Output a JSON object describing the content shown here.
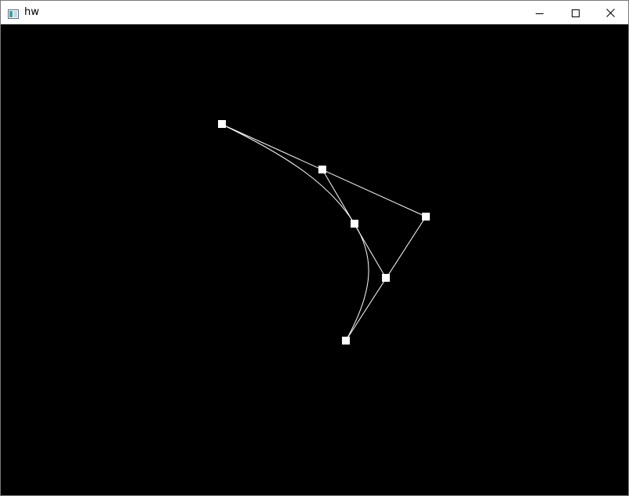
{
  "window": {
    "title": "hw",
    "icon": "app-window-icon",
    "controls": {
      "minimize_icon": "minimize-icon",
      "maximize_icon": "maximize-icon",
      "close_icon": "close-icon"
    }
  },
  "canvas": {
    "background": "#000000",
    "stroke_color": "#ffffff",
    "handle_color": "#ffffff"
  }
}
